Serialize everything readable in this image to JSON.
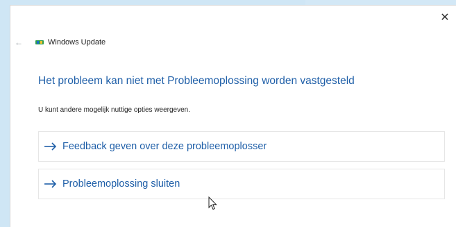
{
  "window": {
    "close_label": "✕",
    "title": "Windows Update",
    "back_label": "←"
  },
  "content": {
    "heading": "Het probleem kan niet met Probleemoplossing worden vastgesteld",
    "subtext": "U kunt andere mogelijk nuttige opties weergeven.",
    "options": [
      {
        "label": "Feedback geven over deze probleemoplosser",
        "icon": "arrow-right-icon"
      },
      {
        "label": "Probleemoplossing sluiten",
        "icon": "arrow-right-icon"
      }
    ]
  },
  "colors": {
    "accent": "#1f5fa8",
    "background": "#cfe6f5",
    "dialog": "#ffffff"
  }
}
